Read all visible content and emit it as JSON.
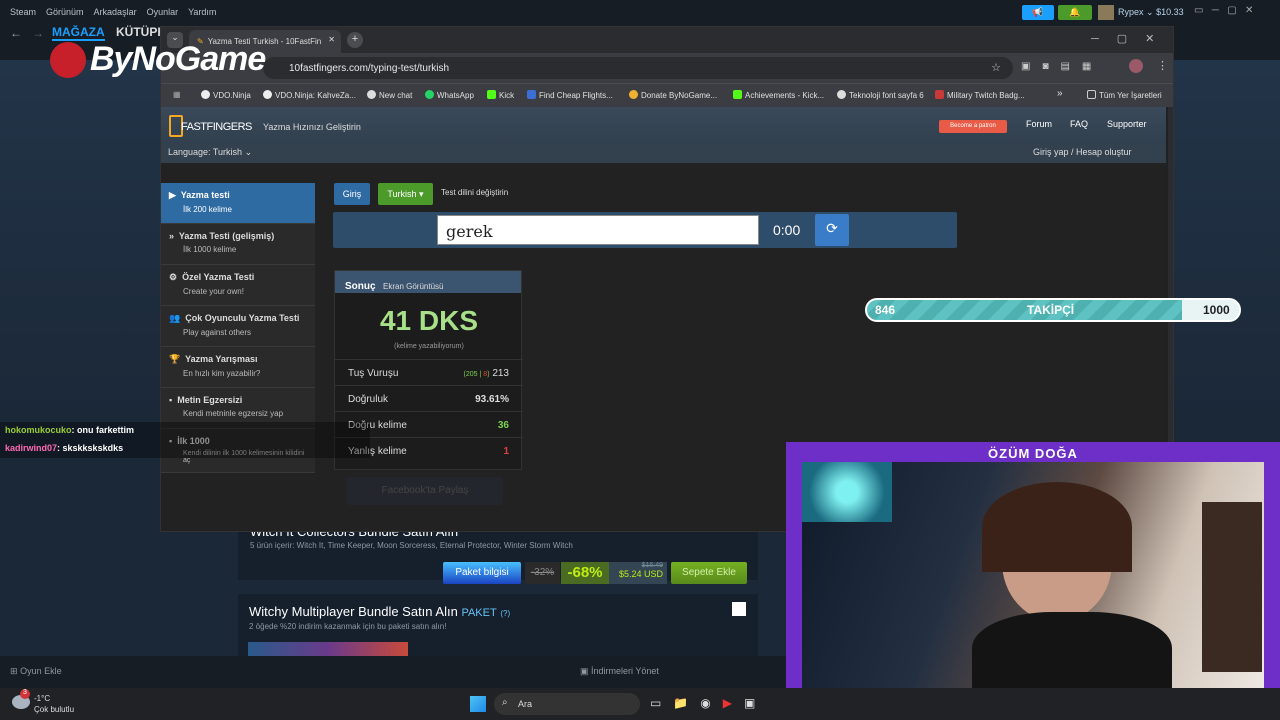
{
  "steam": {
    "menu": [
      "Steam",
      "Görünüm",
      "Arkadaşlar",
      "Oyunlar",
      "Yardım"
    ],
    "user": "Rypex",
    "balance": "$10.33",
    "nav_store": "MAĞAZA",
    "nav_library": "KÜTÜPH",
    "bundle1_title": "Witch It Collectors Bundle Satın Alın",
    "bundle1_items": "5 ürün içerir: Witch It, Time Keeper, Moon Sorceress, Eternal Protector, Winter Storm Witch",
    "bundle_info_button": "Paket bilgisi",
    "old_discount": "-32%",
    "discount": "-68%",
    "old_price": "$16.49",
    "price": "$5.24 USD",
    "add_to_cart": "Sepete Ekle",
    "bundle2_title": "Witchy Multiplayer Bundle Satın Alın",
    "bundle2_tag": "PAKET",
    "bundle2_help": "(?)",
    "bundle2_desc": "2 öğede %20 indirim kazanmak için bu paketi satın alın!",
    "add_game": "Oyun Ekle",
    "downloads": "İndirmeleri Yönet",
    "colors": {
      "accent": "#1a9fff",
      "green": "#4c6b22",
      "discount_bg": "#4c6b22",
      "discount_text": "#beee11"
    }
  },
  "logo": {
    "text": "ByNoGame"
  },
  "chrome": {
    "tab_title": "Yazma Testi Turkish - 10FastFin",
    "url": "10fastfingers.com/typing-test/turkish",
    "bookmarks": [
      "VDO.Ninja",
      "VDO.Ninja: KahveZa...",
      "New chat",
      "WhatsApp",
      "Kick",
      "Find Cheap Flights...",
      "Donate ByNoGame...",
      "Achievements - Kick...",
      "Teknoloji font sayfa 6",
      "Military Twitch Badg..."
    ],
    "bookmarks_overflow": "»",
    "all_bookmarks": "Tüm Yer İşaretleri"
  },
  "ff": {
    "logo": "FASTFINGERS",
    "tagline": "Yazma Hızınızı Geliştirin",
    "patron": "Become a patron",
    "forum": "Forum",
    "faq": "FAQ",
    "supporter": "Supporter",
    "language": "Language: Turkish",
    "login": "Giriş yap / Hesap oluştur",
    "sidebar": [
      {
        "title": "Yazma testi",
        "sub": "İlk 200 kelime",
        "icon": "▶"
      },
      {
        "title": "Yazma Testi (gelişmiş)",
        "sub": "İlk 1000 kelime",
        "icon": "»"
      },
      {
        "title": "Özel Yazma Testi",
        "sub": "Create your own!",
        "icon": "⚙"
      },
      {
        "title": "Çok Oyunculu Yazma Testi",
        "sub": "Play against others",
        "icon": "👥"
      },
      {
        "title": "Yazma Yarışması",
        "sub": "En hızlı kim yazabilir?",
        "icon": "🏆"
      },
      {
        "title": "Metin Egzersizi",
        "sub": "Kendi metninle egzersiz yap",
        "icon": "▪"
      },
      {
        "title": "İlk 1000",
        "sub": "Kendi dilinin ilk 1000 kelimesinin kilidini aç",
        "icon": "▪"
      }
    ],
    "btn_login": "Giriş",
    "btn_lang": "Turkish ▾",
    "change_lang": "Test dilini değiştirin",
    "current_word": "gerek",
    "timer": "0:00",
    "result_title": "Sonuç",
    "screenshot": "Ekran Görüntüsü",
    "wpm": "41 DKS",
    "wpm_sub": "(kelime yazabiliyorum)",
    "keystrokes_label": "Tuş Vuruşu",
    "keystrokes_correct": "205",
    "keystrokes_wrong": "8",
    "keystrokes_total": "213",
    "accuracy_label": "Doğruluk",
    "accuracy": "93.61%",
    "correct_label": "Doğru kelime",
    "correct": "36",
    "wrong_label": "Yanlış kelime",
    "wrong": "1",
    "facebook": "Facebook'ta Paylaş"
  },
  "follower": {
    "current": "846",
    "label": "TAKİPÇİ",
    "goal": "1000",
    "progress": 0.846
  },
  "chat": [
    {
      "user": "hokomukocuko",
      "text": ": onu farkettim",
      "color": "#9acd32"
    },
    {
      "user": "kadirwind07",
      "text": ": skskkskskdks",
      "color": "#ff69b4"
    }
  ],
  "webcam": {
    "name": "ÖZÜM DOĞA"
  },
  "taskbar": {
    "weather_temp": "-1°C",
    "weather_desc": "Çok bulutlu",
    "search": "Ara",
    "badge": "3"
  }
}
